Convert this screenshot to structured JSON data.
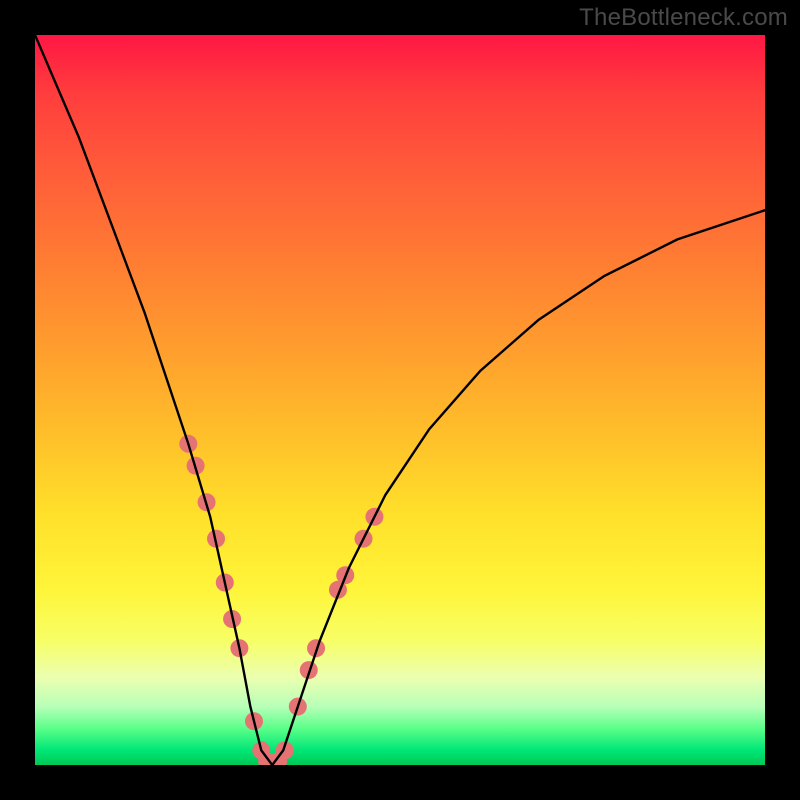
{
  "watermark": "TheBottleneck.com",
  "chart_data": {
    "type": "line",
    "title": "",
    "xlabel": "",
    "ylabel": "",
    "xlim": [
      0,
      100
    ],
    "ylim": [
      0,
      100
    ],
    "grid": false,
    "series": [
      {
        "name": "bottleneck-curve",
        "x": [
          0,
          3,
          6,
          9,
          12,
          15,
          18,
          21,
          24,
          26,
          28,
          29.5,
          31,
          32.5,
          34,
          36,
          39,
          43,
          48,
          54,
          61,
          69,
          78,
          88,
          100
        ],
        "y": [
          100,
          93,
          86,
          78,
          70,
          62,
          53,
          44,
          34,
          25,
          16,
          8,
          2,
          0,
          2,
          8,
          17,
          27,
          37,
          46,
          54,
          61,
          67,
          72,
          76
        ],
        "color": "#000000"
      }
    ],
    "scatter_points": {
      "name": "highlighted-points",
      "color": "#e57373",
      "radius_px": 9,
      "points": [
        {
          "x": 21.0,
          "y": 44
        },
        {
          "x": 22.0,
          "y": 41
        },
        {
          "x": 23.5,
          "y": 36
        },
        {
          "x": 24.8,
          "y": 31
        },
        {
          "x": 26.0,
          "y": 25
        },
        {
          "x": 27.0,
          "y": 20
        },
        {
          "x": 28.0,
          "y": 16
        },
        {
          "x": 30.0,
          "y": 6
        },
        {
          "x": 31.0,
          "y": 2
        },
        {
          "x": 31.8,
          "y": 0.5
        },
        {
          "x": 32.5,
          "y": 0
        },
        {
          "x": 33.3,
          "y": 0.5
        },
        {
          "x": 34.2,
          "y": 2
        },
        {
          "x": 36.0,
          "y": 8
        },
        {
          "x": 37.5,
          "y": 13
        },
        {
          "x": 38.5,
          "y": 16
        },
        {
          "x": 41.5,
          "y": 24
        },
        {
          "x": 42.5,
          "y": 26
        },
        {
          "x": 45.0,
          "y": 31
        },
        {
          "x": 46.5,
          "y": 34
        }
      ]
    },
    "legend": false
  }
}
